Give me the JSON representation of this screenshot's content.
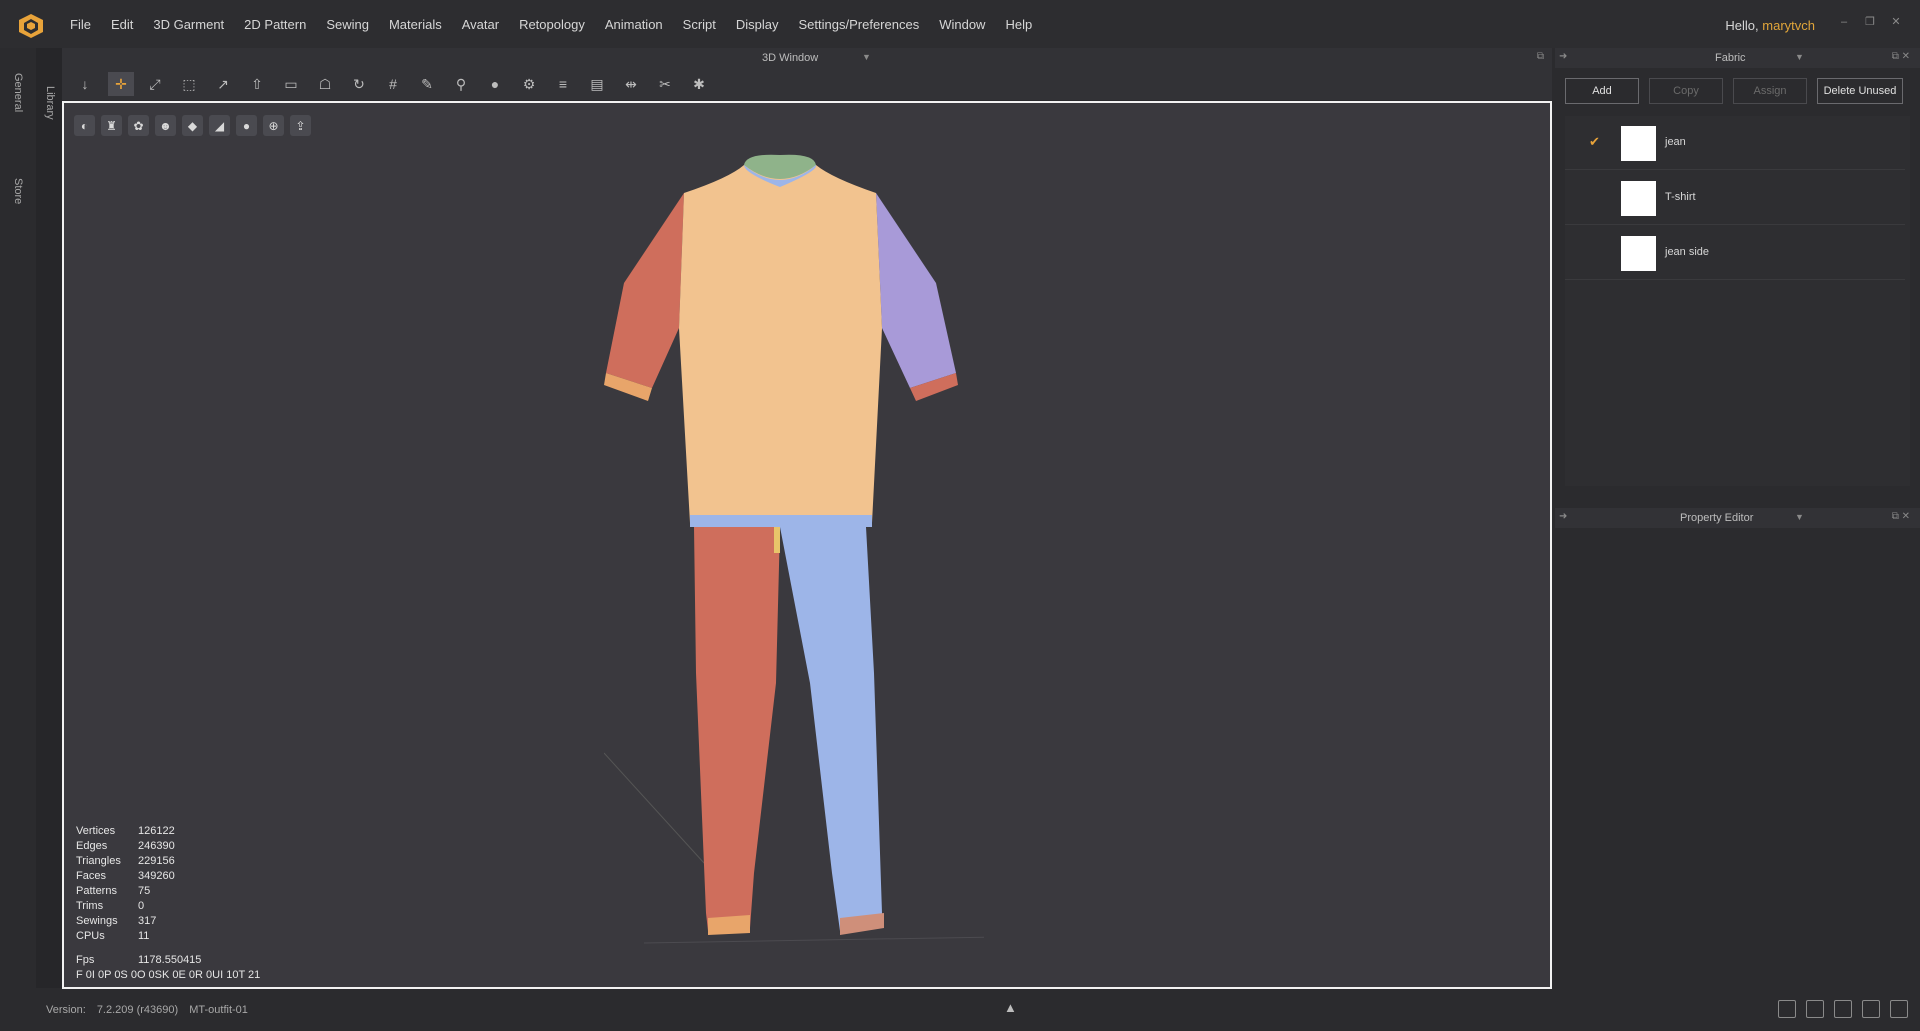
{
  "menubar": {
    "items": [
      "File",
      "Edit",
      "3D Garment",
      "2D Pattern",
      "Sewing",
      "Materials",
      "Avatar",
      "Retopology",
      "Animation",
      "Script",
      "Display",
      "Settings/Preferences",
      "Window",
      "Help"
    ],
    "greeting": "Hello,",
    "username": "marytvch"
  },
  "side_tabs": {
    "general": "General",
    "library": "Library",
    "store": "Store"
  },
  "window3d": {
    "title": "3D Window",
    "stats": [
      {
        "label": "Vertices",
        "value": "126122"
      },
      {
        "label": "Edges",
        "value": "246390"
      },
      {
        "label": "Triangles",
        "value": "229156"
      },
      {
        "label": "Faces",
        "value": "349260"
      },
      {
        "label": "Patterns",
        "value": "75"
      },
      {
        "label": "Trims",
        "value": "0"
      },
      {
        "label": "Sewings",
        "value": "317"
      },
      {
        "label": "CPUs",
        "value": "11"
      }
    ],
    "fps_label": "Fps",
    "fps_value": "1178.550415",
    "timing": "F 0I 0P 0S 0O 0SK 0E 0R 0UI 10T 21"
  },
  "fabric_panel": {
    "title": "Fabric",
    "buttons": {
      "add": "Add",
      "copy": "Copy",
      "assign": "Assign",
      "delete_unused": "Delete Unused"
    },
    "items": [
      {
        "name": "jean",
        "checked": true,
        "swatch": "#ffffff"
      },
      {
        "name": "T-shirt",
        "checked": false,
        "swatch": "#ffffff"
      },
      {
        "name": "jean side",
        "checked": false,
        "swatch": "#ffffff"
      }
    ]
  },
  "property_editor": {
    "title": "Property Editor"
  },
  "statusbar": {
    "version_label": "Version:",
    "version": "7.2.209 (r43690)",
    "project": "MT-outfit-01"
  },
  "colors": {
    "accent": "#e8a33a",
    "viewport_bg": "#3a393e",
    "tshirt": "#f2c38f",
    "sleeve_left": "#cf6e5c",
    "sleeve_right": "#a89ad8",
    "pants_left": "#cf6e5c",
    "pants_right": "#9db5e8"
  }
}
